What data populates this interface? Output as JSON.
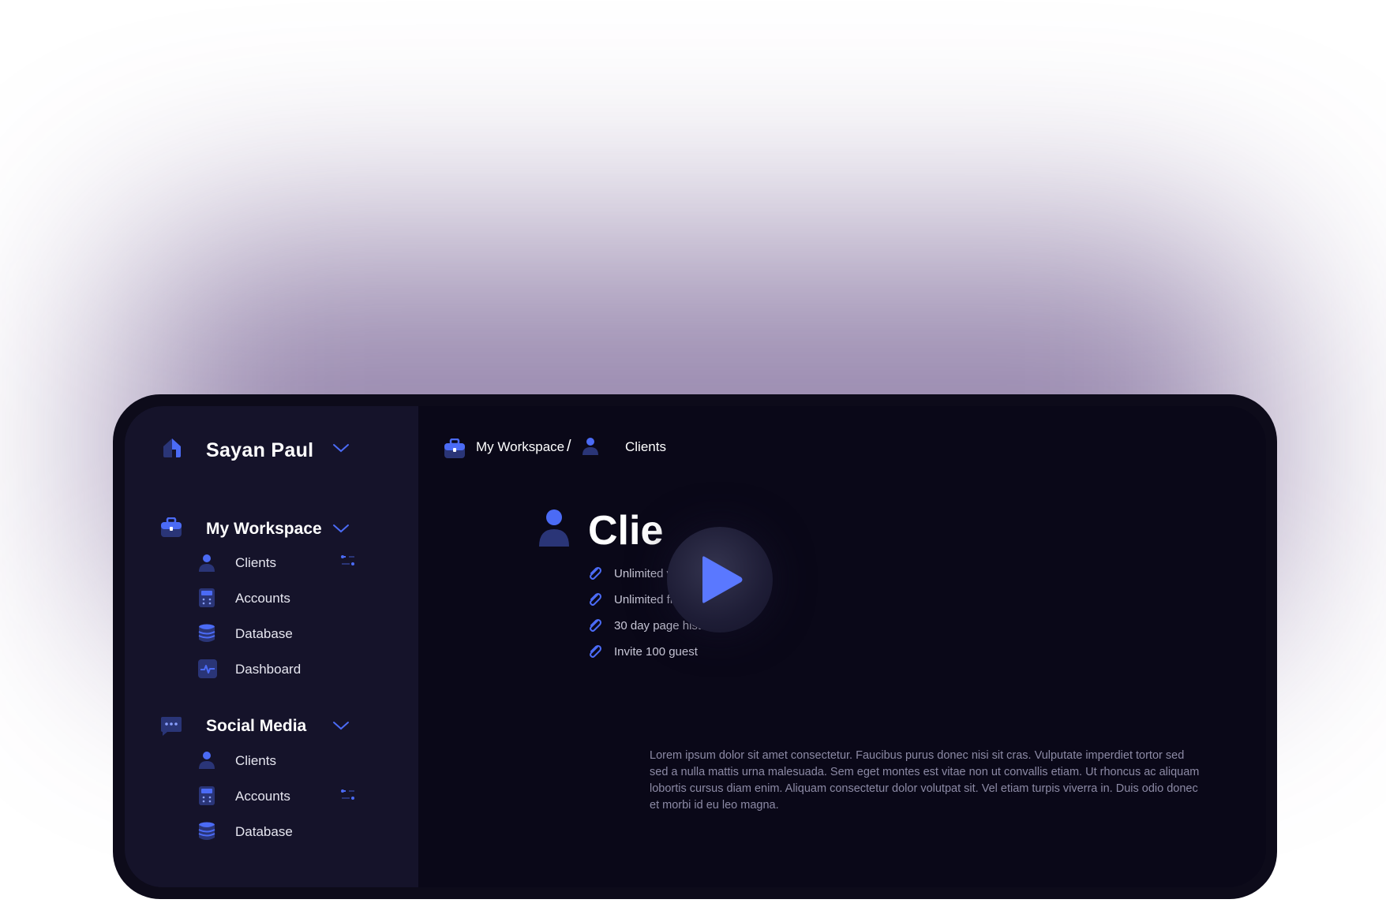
{
  "colors": {
    "accent": "#4b6bf5",
    "accent_dark": "#2a3577",
    "sidebar_bg": "#15132a",
    "main_bg": "#0a0818",
    "device_frame": "#0d0b1a"
  },
  "sidebar": {
    "user_name": "Sayan Paul",
    "sections": [
      {
        "title": "My Workspace",
        "icon": "briefcase-icon",
        "items": [
          {
            "label": "Clients",
            "icon": "user-icon"
          },
          {
            "label": "Accounts",
            "icon": "calculator-icon"
          },
          {
            "label": "Database",
            "icon": "database-icon"
          },
          {
            "label": "Dashboard",
            "icon": "activity-icon"
          }
        ]
      },
      {
        "title": "Social Media",
        "icon": "chat-icon",
        "items": [
          {
            "label": "Clients",
            "icon": "user-icon"
          },
          {
            "label": "Accounts",
            "icon": "calculator-icon"
          },
          {
            "label": "Database",
            "icon": "database-icon"
          }
        ]
      }
    ]
  },
  "breadcrumb": {
    "items": [
      {
        "label": "My Workspace",
        "icon": "briefcase-icon"
      },
      {
        "label": "Clients",
        "icon": "user-icon"
      }
    ],
    "separator": "/"
  },
  "main": {
    "title": "Clie",
    "features": [
      "Unlimited w",
      "Unlimited file Uploads",
      "30 day page history",
      "Invite 100 guest"
    ],
    "description": "Lorem ipsum dolor sit amet consectetur. Faucibus purus donec nisi sit cras. Vulputate imperdiet tortor sed sed a nulla mattis urna malesuada. Sem eget montes est vitae non ut convallis etiam. Ut rhoncus ac aliquam lobortis cursus diam enim. Aliquam consectetur dolor volutpat sit. Vel etiam turpis viverra in. Duis odio donec et morbi id eu leo magna."
  },
  "video": {
    "icon": "play-icon"
  }
}
